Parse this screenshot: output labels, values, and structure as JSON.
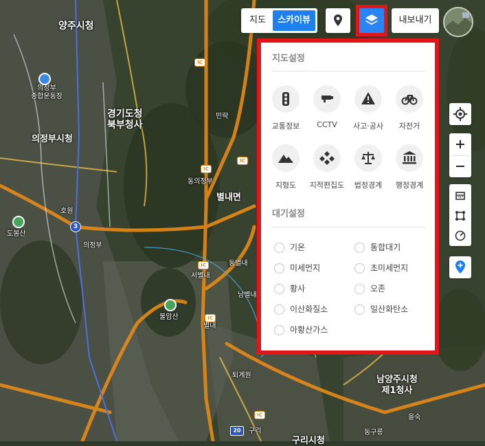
{
  "map_labels": [
    {
      "name": "yangju-city-hall",
      "text": "양주시청"
    },
    {
      "name": "uijeongbu-st-mary",
      "text": "의정부\n종합운동장"
    },
    {
      "name": "uijeongbu-city-hall",
      "text": "의정부시청"
    },
    {
      "name": "gyeonggi-north",
      "text": "경기도청\n북부청사"
    },
    {
      "name": "minrak",
      "text": "민락"
    },
    {
      "name": "dongdu",
      "text": "동의정부"
    },
    {
      "name": "byeollaemyeon",
      "text": "별내면"
    },
    {
      "name": "dobongsan",
      "text": "도봉산"
    },
    {
      "name": "uijeongbu-ic",
      "text": "의정부"
    },
    {
      "name": "hoeryong",
      "text": "호원"
    },
    {
      "name": "byeollae-ic",
      "text": "동별내"
    },
    {
      "name": "seobyeollae",
      "text": "서별내"
    },
    {
      "name": "buramsan",
      "text": "불암산"
    },
    {
      "name": "nambyeollae",
      "text": "남별내"
    },
    {
      "name": "byeollae",
      "text": "별내"
    },
    {
      "name": "toegyewon",
      "text": "퇴계원"
    },
    {
      "name": "namyangju-hall",
      "text": "남양주시청\n제1청사"
    },
    {
      "name": "guri",
      "text": "구리"
    },
    {
      "name": "guri-city-hall",
      "text": "구리시청"
    },
    {
      "name": "eulsuk",
      "text": "을숙"
    },
    {
      "name": "donggureung",
      "text": "동구릉"
    }
  ],
  "toolbar": {
    "map_label": "지도",
    "skyview_label": "스카이뷰",
    "export_label": "내보내기"
  },
  "panel": {
    "map_settings_title": "지도설정",
    "map_tiles": [
      {
        "label": "교통정보",
        "icon": "traffic-light-icon"
      },
      {
        "label": "CCTV",
        "icon": "cctv-icon"
      },
      {
        "label": "사고·공사",
        "icon": "warning-icon"
      },
      {
        "label": "자전거",
        "icon": "bicycle-icon"
      },
      {
        "label": "지형도",
        "icon": "mountain-icon"
      },
      {
        "label": "지적편집도",
        "icon": "parcel-icon"
      },
      {
        "label": "법정경계",
        "icon": "scale-icon"
      },
      {
        "label": "행정경계",
        "icon": "government-building-icon"
      }
    ],
    "air_settings_title": "대기설정",
    "air_options": [
      "기온",
      "통합대기",
      "미세먼지",
      "초미세먼지",
      "황사",
      "오존",
      "이산화질소",
      "일산화탄소",
      "아황산가스"
    ]
  },
  "colors": {
    "accent": "#1e7ff0",
    "highlight": "#e3151a",
    "road": "#e68a17"
  }
}
